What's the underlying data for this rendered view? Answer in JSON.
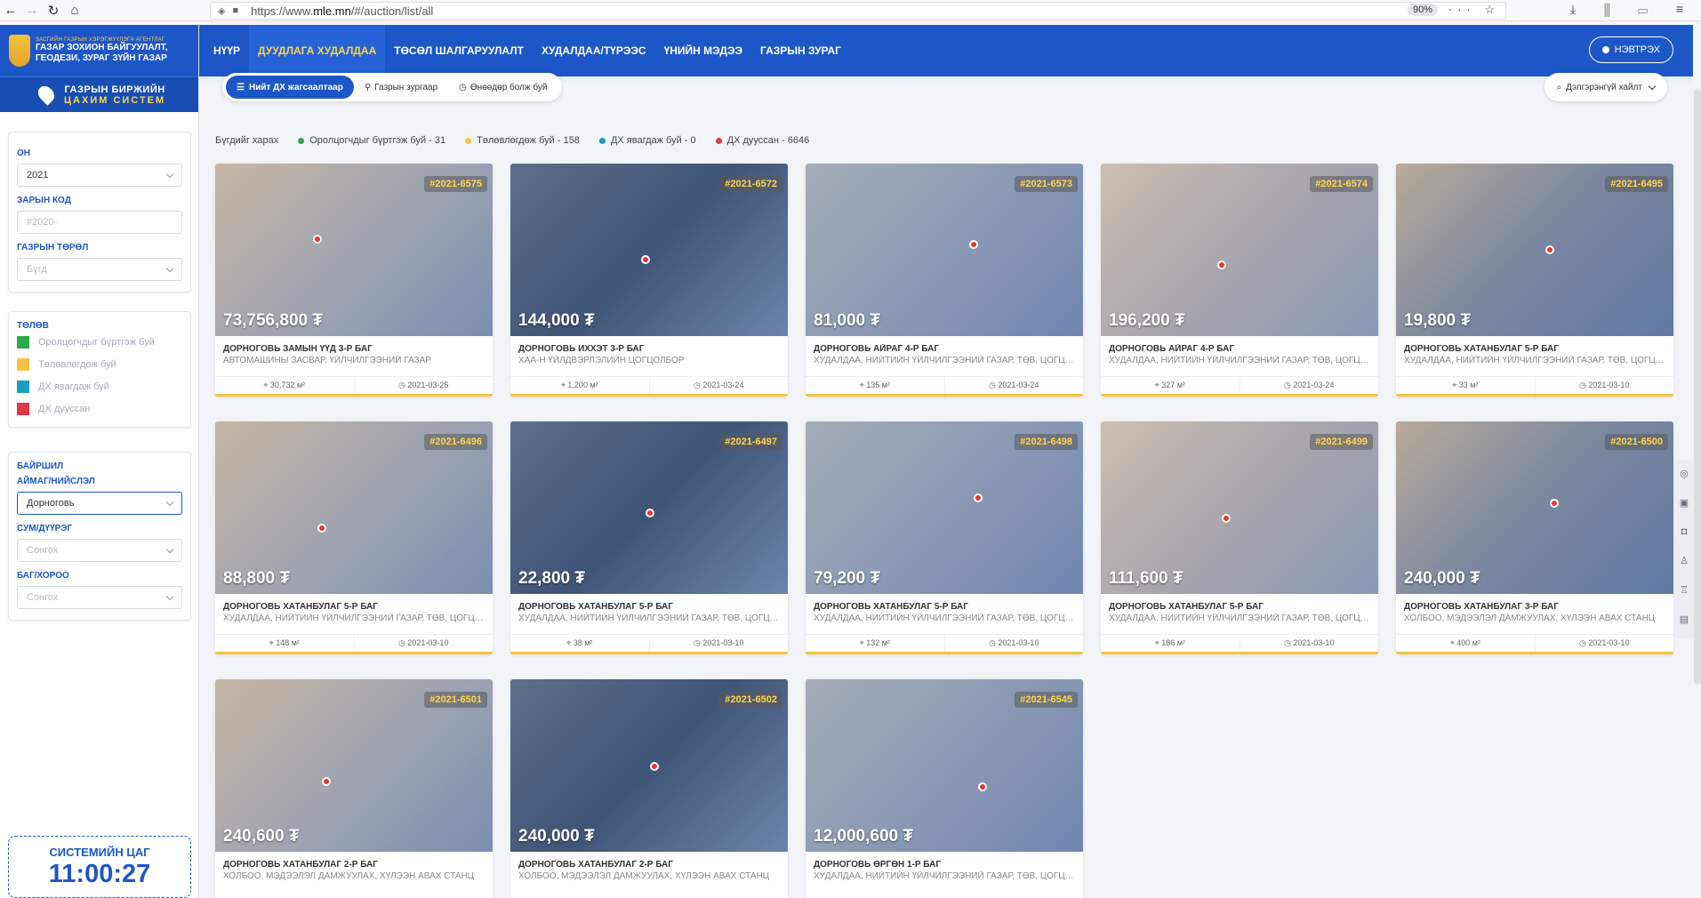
{
  "browser": {
    "url_prefix": "https://www.",
    "url_domain": "mle.mn",
    "url_path": "/#/auction/list/all",
    "zoom": "90%"
  },
  "sidebar": {
    "org_small": "ЗАСГИЙН ГАЗРЫН ХЭРЭГЖҮҮЛЭГЧ АГЕНТЛАГ",
    "org_line1": "ГАЗАР ЗОХИОН БАЙГУУЛАЛТ,",
    "org_line2": "ГЕОДЕЗИ, ЗУРАГ ЗҮЙН ГАЗАР",
    "exchange_line1": "ГАЗРЫН БИРЖИЙН",
    "exchange_line2": "ЦАХИМ СИСТЕМ",
    "filters": {
      "year_label": "ОН",
      "year_value": "2021",
      "code_label": "ЗАРЫН КОД",
      "code_placeholder": "#2020-",
      "type_label": "ГАЗРЫН ТӨРӨЛ",
      "type_value": "Бүгд"
    },
    "status": {
      "title": "ТӨЛӨВ",
      "items": [
        {
          "label": "Оролцогчдыг бүртгэж буй",
          "color": "#2aa84a"
        },
        {
          "label": "Төлөвлөгдөж буй",
          "color": "#f5c342"
        },
        {
          "label": "ДХ явагдаж буй",
          "color": "#1a9fc0"
        },
        {
          "label": "ДХ дууссан",
          "color": "#e03848"
        }
      ]
    },
    "location": {
      "title": "БАЙРШИЛ",
      "aimag_label": "АЙМАГ/НИЙСЛЭЛ",
      "aimag_value": "Дорноговь",
      "sum_label": "СУМ/ДҮҮРЭГ",
      "sum_value": "Сонгох",
      "bag_label": "БАГ/ХОРОО",
      "bag_value": "Сонгох"
    },
    "clock": {
      "label": "СИСТЕМИЙН ЦАГ",
      "time": "11:00:27"
    }
  },
  "nav": {
    "items": [
      "НҮҮР",
      "ДУУДЛАГА ХУДАЛДАА",
      "ТӨСӨЛ ШАЛГАРУУЛАЛТ",
      "ХУДАЛДАА/ТҮРЭЭС",
      "ҮНИЙН МЭДЭЭ",
      "ГАЗРЫН ЗУРАГ"
    ],
    "login": "НЭВТРЭХ"
  },
  "tabs": [
    "Нийт ДХ жагсаалтаар",
    "Газрын зургаар",
    "Өнөөдөр болж буй"
  ],
  "advanced_search": "Дэлгэрэнгүй хайлт",
  "filter_line": {
    "view_all": "Бүгдийг харах",
    "items": [
      {
        "label": "Оролцогчдыг бүртгэж буй - 31",
        "color": "#2aa84a"
      },
      {
        "label": "Төлөвлөгдөж буй - 158",
        "color": "#f5c342"
      },
      {
        "label": "ДХ явагдаж буй - 0",
        "color": "#1a9fc0"
      },
      {
        "label": "ДХ дууссан - 6646",
        "color": "#e03848"
      }
    ]
  },
  "cards": [
    {
      "code": "#2021-6575",
      "price": "73,756,800 ₮",
      "location": "ДОРНОГОВЬ ЗАМЫН ҮҮД 3-Р БАГ",
      "purpose": "АВТОМАШИНЫ ЗАСВАР, ҮЙЛЧИЛГЭЭНИЙ ГАЗАР",
      "area": "30,732 м²",
      "date": "2021-03-25"
    },
    {
      "code": "#2021-6572",
      "price": "144,000 ₮",
      "location": "ДОРНОГОВЬ ИХХЭТ 3-Р БАГ",
      "purpose": "ХАА-Н ҮЙЛДВЭРЛЭЛИЙН ЦОГЦОЛБОР",
      "area": "1,200 м²",
      "date": "2021-03-24"
    },
    {
      "code": "#2021-6573",
      "price": "81,000 ₮",
      "location": "ДОРНОГОВЬ АЙРАГ 4-Р БАГ",
      "purpose": "ХУДАЛДАА, НИЙТИЙН ҮЙЛЧИЛГЭЭНИЙ ГАЗАР, ТӨВ, ЦОГЦОЛБОР",
      "area": "135 м²",
      "date": "2021-03-24"
    },
    {
      "code": "#2021-6574",
      "price": "196,200 ₮",
      "location": "ДОРНОГОВЬ АЙРАГ 4-Р БАГ",
      "purpose": "ХУДАЛДАА, НИЙТИЙН ҮЙЛЧИЛГЭЭНИЙ ГАЗАР, ТӨВ, ЦОГЦОЛБОР",
      "area": "327 м²",
      "date": "2021-03-24"
    },
    {
      "code": "#2021-6495",
      "price": "19,800 ₮",
      "location": "ДОРНОГОВЬ ХАТАНБУЛАГ 5-Р БАГ",
      "purpose": "ХУДАЛДАА, НИЙТИЙН ҮЙЛЧИЛГЭЭНИЙ ГАЗАР, ТӨВ, ЦОГЦОЛБОР",
      "area": "33 м²",
      "date": "2021-03-10"
    },
    {
      "code": "#2021-6496",
      "price": "88,800 ₮",
      "location": "ДОРНОГОВЬ ХАТАНБУЛАГ 5-Р БАГ",
      "purpose": "ХУДАЛДАА, НИЙТИЙН ҮЙЛЧИЛГЭЭНИЙ ГАЗАР, ТӨВ, ЦОГЦОЛБОР",
      "area": "148 м²",
      "date": "2021-03-10"
    },
    {
      "code": "#2021-6497",
      "price": "22,800 ₮",
      "location": "ДОРНОГОВЬ ХАТАНБУЛАГ 5-Р БАГ",
      "purpose": "ХУДАЛДАА, НИЙТИЙН ҮЙЛЧИЛГЭЭНИЙ ГАЗАР, ТӨВ, ЦОГЦОЛБОР",
      "area": "38 м²",
      "date": "2021-03-10"
    },
    {
      "code": "#2021-6498",
      "price": "79,200 ₮",
      "location": "ДОРНОГОВЬ ХАТАНБУЛАГ 5-Р БАГ",
      "purpose": "ХУДАЛДАА, НИЙТИЙН ҮЙЛЧИЛГЭЭНИЙ ГАЗАР, ТӨВ, ЦОГЦОЛБОР",
      "area": "132 м²",
      "date": "2021-03-10"
    },
    {
      "code": "#2021-6499",
      "price": "111,600 ₮",
      "location": "ДОРНОГОВЬ ХАТАНБУЛАГ 5-Р БАГ",
      "purpose": "ХУДАЛДАА, НИЙТИЙН ҮЙЛЧИЛГЭЭНИЙ ГАЗАР, ТӨВ, ЦОГЦОЛБОР",
      "area": "186 м²",
      "date": "2021-03-10"
    },
    {
      "code": "#2021-6500",
      "price": "240,000 ₮",
      "location": "ДОРНОГОВЬ ХАТАНБУЛАГ 3-Р БАГ",
      "purpose": "ХОЛБОО, МЭДЭЭЛЭЛ ДАМЖУУЛАХ, ХҮЛЭЭН АВАХ СТАНЦ",
      "area": "400 м²",
      "date": "2021-03-10"
    },
    {
      "code": "#2021-6501",
      "price": "240,600 ₮",
      "location": "ДОРНОГОВЬ ХАТАНБУЛАГ 2-Р БАГ",
      "purpose": "ХОЛБОО, МЭДЭЭЛЭЛ ДАМЖУУЛАХ, ХҮЛЭЭН АВАХ СТАНЦ",
      "area": "",
      "date": ""
    },
    {
      "code": "#2021-6502",
      "price": "240,000 ₮",
      "location": "ДОРНОГОВЬ ХАТАНБУЛАГ 2-Р БАГ",
      "purpose": "ХОЛБОО, МЭДЭЭЛЭЛ ДАМЖУУЛАХ, ХҮЛЭЭН АВАХ СТАНЦ",
      "area": "",
      "date": ""
    },
    {
      "code": "#2021-6545",
      "price": "12,000,600 ₮",
      "location": "ДОРНОГОВЬ ӨРГӨН 1-Р БАГ",
      "purpose": "ХУДАЛДАА, НИЙТИЙН ҮЙЛЧИЛГЭЭНИЙ ГАЗАР, ТӨВ, ЦОГЦОЛБОР",
      "area": "",
      "date": ""
    }
  ]
}
